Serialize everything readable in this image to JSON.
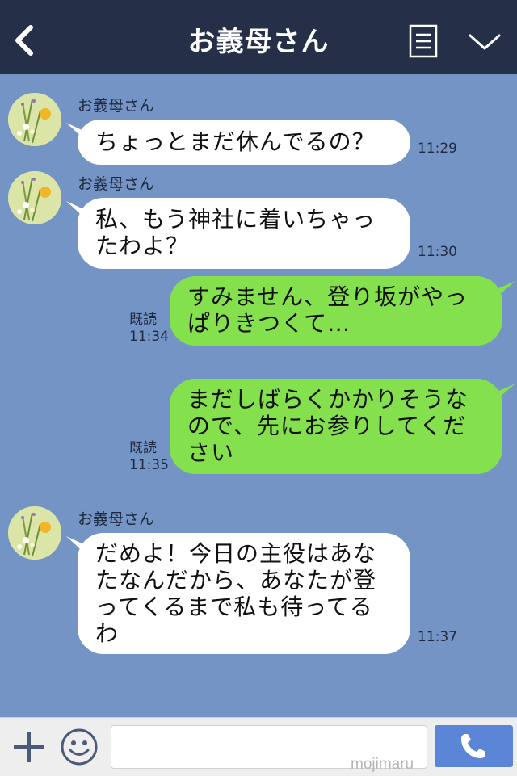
{
  "header": {
    "title": "お義母さん",
    "back_icon": "chevron-left-icon",
    "menu_icon": "menu-icon",
    "expand_icon": "chevron-down-icon"
  },
  "messages": [
    {
      "sender": "お義母さん",
      "text": "ちょっとまだ休んでるの？",
      "time": "11:29",
      "direction": "in"
    },
    {
      "sender": "お義母さん",
      "text": "私、もう神社に着いちゃっ\nたわよ？",
      "time": "11:30",
      "direction": "in"
    },
    {
      "text": "すみません、登り坂がやっ\nぱりきつくて…",
      "status": "既読",
      "time": "11:34",
      "direction": "out"
    },
    {
      "text": "まだしばらくかかりそうな\nので、先にお参りしてくだ\nさい",
      "status": "既読",
      "time": "11:35",
      "direction": "out"
    },
    {
      "sender": "お義母さん",
      "text": "だめよ！今日の主役はあな\nたなんだから、あなたが登\nってくるまで私も待ってる\nわ",
      "time": "11:37",
      "direction": "in"
    }
  ],
  "input_bar": {
    "placeholder": "",
    "watermark": "mojimaru",
    "plus_icon": "plus-icon",
    "emoji_icon": "smiley-icon",
    "call_icon": "phone-icon"
  },
  "colors": {
    "background": "#7394c5",
    "header": "#253048",
    "outgoing_bubble": "#84e04c",
    "incoming_bubble": "#ffffff",
    "call_button": "#5b86d8"
  }
}
